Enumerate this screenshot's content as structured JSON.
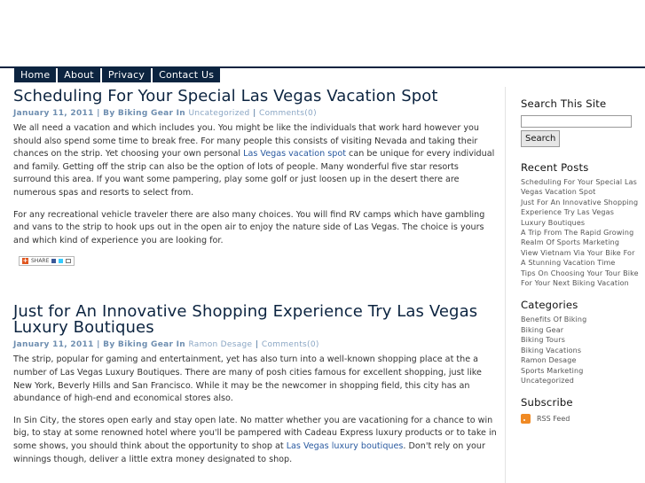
{
  "nav": {
    "items": [
      "Home",
      "About",
      "Privacy",
      "Contact Us"
    ]
  },
  "posts": [
    {
      "title": "Scheduling For Your Special Las Vegas Vacation Spot",
      "date": "January 11, 2011",
      "by": "By Biking Gear In",
      "category": "Uncategorized",
      "comments": "Comments(0)",
      "p1_a": "We all need a vacation and which includes you. You might be like the individuals that work hard however you should also spend some time to break free. For many people this consists of visiting Nevada and taking their chances on the strip. Yet choosing your own personal ",
      "p1_link": "Las Vegas vacation spot",
      "p1_b": " can be unique for every individual and family. Getting off the strip can also be the option of lots of people. Many wonderful five star resorts surround this area. If you want some pampering, play some golf or just loosen up in the desert there are numerous spas and resorts to select from.",
      "p2": "For any recreational vehicle traveler there are also many choices. You will find RV camps which have gambling and vans to the strip to hook ups out in the open air to enjoy the nature side of Las Vegas. The choice is yours and which kind of experience you are looking for.",
      "share": "SHARE"
    },
    {
      "title": "Just for An Innovative Shopping Experience Try Las Vegas Luxury Boutiques",
      "date": "January 11, 2011",
      "by": "By Biking Gear In",
      "category": "Ramon Desage",
      "comments": "Comments(0)",
      "p1": "The strip, popular for gaming and entertainment, yet has also turn into a well-known shopping place at the a number of Las Vegas Luxury Boutiques. There are many of posh cities famous for excellent shopping, just like New York, Beverly Hills and San Francisco. While it may be the newcomer in shopping field, this city has an abundance of high-end and economical stores also.",
      "p2_a": "In Sin City, the stores open early and stay open late. No matter whether you are vacationing for a chance to win big, to stay at some renowned hotel where you'll be pampered with Cadeau Express luxury products or to take in some shows, you should think about the opportunity to shop at ",
      "p2_link": "Las Vegas luxury boutiques",
      "p2_b": ". Don't rely on your winnings though, deliver a little extra money designated to shop."
    }
  ],
  "sidebar": {
    "search_title": "Search This Site",
    "search_button": "Search",
    "recent_title": "Recent Posts",
    "recent": [
      "Scheduling For Your Special Las Vegas Vacation Spot",
      "Just For An Innovative Shopping Experience Try Las Vegas Luxury Boutiques",
      "A Trip From The Rapid Growing Realm Of Sports Marketing",
      "View Vietnam Via Your Bike For A Stunning Vacation Time",
      "Tips On Choosing Your Tour Bike For Your Next Biking Vacation"
    ],
    "categories_title": "Categories",
    "categories": [
      "Benefits Of Biking",
      "Biking Gear",
      "Biking Tours",
      "Biking Vacations",
      "Ramon Desage",
      "Sports Marketing",
      "Uncategorized"
    ],
    "subscribe_title": "Subscribe",
    "rss": "RSS Feed"
  }
}
